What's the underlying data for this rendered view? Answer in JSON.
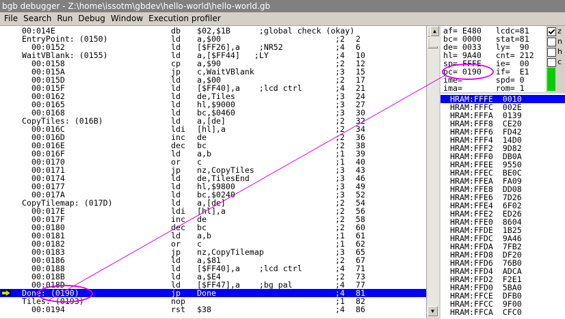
{
  "window": {
    "title": "bgb debugger - Z:\\home\\issotm\\gbdev\\hello-world\\hello-world.gb"
  },
  "menu": [
    "File",
    "Search",
    "Run",
    "Debug",
    "Window",
    "Execution profiler"
  ],
  "code": [
    {
      "addr": "00:014E",
      "op": "db",
      "arg": "$02,$1B      ;global check (okay)",
      "cyc": "",
      "len": ""
    },
    {
      "addr": "EntryPoint: (0150)",
      "op": "ld",
      "arg": "a,$00",
      "cyc": ";2",
      "len": "2",
      "label": true
    },
    {
      "addr": "  00:0152",
      "op": "ld",
      "arg": "[$FF26],a    ;NR52",
      "cyc": ";4",
      "len": "6"
    },
    {
      "addr": "WaitVBlank: (0155)",
      "op": "ld",
      "arg": "a,[$FF44]   ;LY",
      "cyc": ";4",
      "len": "10",
      "label": true
    },
    {
      "addr": "  00:0158",
      "op": "cp",
      "arg": "a,$90",
      "cyc": ";2",
      "len": "12"
    },
    {
      "addr": "  00:015A",
      "op": "jp",
      "arg": "c,WaitVBlank",
      "cyc": ";3",
      "len": "15"
    },
    {
      "addr": "  00:015D",
      "op": "ld",
      "arg": "a,$00",
      "cyc": ";2",
      "len": "17"
    },
    {
      "addr": "  00:015F",
      "op": "ld",
      "arg": "[$FF40],a    ;lcd ctrl",
      "cyc": ";4",
      "len": "21"
    },
    {
      "addr": "  00:0162",
      "op": "ld",
      "arg": "de,Tiles",
      "cyc": ";3",
      "len": "24"
    },
    {
      "addr": "  00:0165",
      "op": "ld",
      "arg": "hl,$9000",
      "cyc": ";3",
      "len": "27"
    },
    {
      "addr": "  00:0168",
      "op": "ld",
      "arg": "bc,$0460",
      "cyc": ";3",
      "len": "30"
    },
    {
      "addr": "CopyTiles: (016B)",
      "op": "ld",
      "arg": "a,[de]",
      "cyc": ";2",
      "len": "32",
      "label": true
    },
    {
      "addr": "  00:016C",
      "op": "ldi",
      "arg": "[hl],a",
      "cyc": ";2",
      "len": "34"
    },
    {
      "addr": "  00:016D",
      "op": "inc",
      "arg": "de",
      "cyc": ";2",
      "len": "36"
    },
    {
      "addr": "  00:016E",
      "op": "dec",
      "arg": "bc",
      "cyc": ";2",
      "len": "38"
    },
    {
      "addr": "  00:016F",
      "op": "ld",
      "arg": "a,b",
      "cyc": ";1",
      "len": "39"
    },
    {
      "addr": "  00:0170",
      "op": "or",
      "arg": "c",
      "cyc": ";1",
      "len": "40"
    },
    {
      "addr": "  00:0171",
      "op": "jp",
      "arg": "nz,CopyTiles",
      "cyc": ";3",
      "len": "43"
    },
    {
      "addr": "  00:0174",
      "op": "ld",
      "arg": "de,TilesEnd",
      "cyc": ";3",
      "len": "46"
    },
    {
      "addr": "  00:0177",
      "op": "ld",
      "arg": "hl,$9800",
      "cyc": ";3",
      "len": "49"
    },
    {
      "addr": "  00:017A",
      "op": "ld",
      "arg": "bc,$0240",
      "cyc": ";3",
      "len": "52"
    },
    {
      "addr": "CopyTilemap: (017D)",
      "op": "ld",
      "arg": "a,[de]",
      "cyc": ";2",
      "len": "54",
      "label": true
    },
    {
      "addr": "  00:017E",
      "op": "ldi",
      "arg": "[hl],a",
      "cyc": ";2",
      "len": "56"
    },
    {
      "addr": "  00:017F",
      "op": "inc",
      "arg": "de",
      "cyc": ";2",
      "len": "58"
    },
    {
      "addr": "  00:0180",
      "op": "dec",
      "arg": "bc",
      "cyc": ";2",
      "len": "60"
    },
    {
      "addr": "  00:0181",
      "op": "ld",
      "arg": "a,b",
      "cyc": ";1",
      "len": "61"
    },
    {
      "addr": "  00:0182",
      "op": "or",
      "arg": "c",
      "cyc": ";1",
      "len": "62"
    },
    {
      "addr": "  00:0183",
      "op": "jp",
      "arg": "nz,CopyTilemap",
      "cyc": ";3",
      "len": "65"
    },
    {
      "addr": "  00:0186",
      "op": "ld",
      "arg": "a,$81",
      "cyc": ";2",
      "len": "67"
    },
    {
      "addr": "  00:0188",
      "op": "ld",
      "arg": "[$FF40],a    ;lcd ctrl",
      "cyc": ";4",
      "len": "71"
    },
    {
      "addr": "  00:018B",
      "op": "ld",
      "arg": "a,$E4",
      "cyc": ";2",
      "len": "73"
    },
    {
      "addr": "  00:018D",
      "op": "ld",
      "arg": "[$FF47],a    ;bg pal",
      "cyc": ";4",
      "len": "77"
    },
    {
      "addr": "Done: (0190)",
      "op": "jp",
      "arg": "Done",
      "cyc": ";4",
      "len": "81",
      "label": true,
      "selected": true
    },
    {
      "addr": "Tiles: (0193)",
      "op": "nop",
      "arg": "",
      "cyc": ";1",
      "len": "82",
      "label": true
    },
    {
      "addr": "  00:0194",
      "op": "rst",
      "arg": "$38",
      "cyc": ";4",
      "len": "86"
    }
  ],
  "registers": [
    "af= E480   lcdc=81",
    "bc= 0000   stat=81",
    "de= 0033   ly=  90",
    "hl= 9A40   cnt= 212",
    "sp= FFFE   ie=  00",
    "pc= 0190   if=  E1",
    "ime=       spd= 0",
    "ima=       rom= 1"
  ],
  "flags": [
    {
      "label": "z",
      "checked": true
    },
    {
      "label": "n",
      "checked": false
    },
    {
      "label": "h",
      "checked": false
    },
    {
      "label": "c",
      "checked": false
    }
  ],
  "stack": [
    "HRAM:FFFE  0010",
    "HRAM:FFFC  002E",
    "HRAM:FFFA  0139",
    "HRAM:FFF8  CE20",
    "HRAM:FFF6  FD42",
    "HRAM:FFF4  14D0",
    "HRAM:FFF2  9D82",
    "HRAM:FFF0  DB0A",
    "HRAM:FFEE  9550",
    "HRAM:FFEC  BE0C",
    "HRAM:FFEA  FA09",
    "HRAM:FFE8  DD08",
    "HRAM:FFE6  7D26",
    "HRAM:FFE4  6F02",
    "HRAM:FFE2  ED26",
    "HRAM:FFE0  8604",
    "HRAM:FFDE  1B25",
    "HRAM:FFDC  9A46",
    "HRAM:FFDA  7FB2",
    "HRAM:FFD8  DF20",
    "HRAM:FFD6  76B0",
    "HRAM:FFD4  ADCA",
    "HRAM:FFD2  F2E1",
    "HRAM:FFD0  5BA0",
    "HRAM:FFCE  DFB0",
    "HRAM:FFCC  9F00",
    "HRAM:FFCA  CFC0"
  ],
  "colors": {
    "selection": "#0000ff",
    "annotation": "#e000e0",
    "status_green": "#00d000"
  }
}
